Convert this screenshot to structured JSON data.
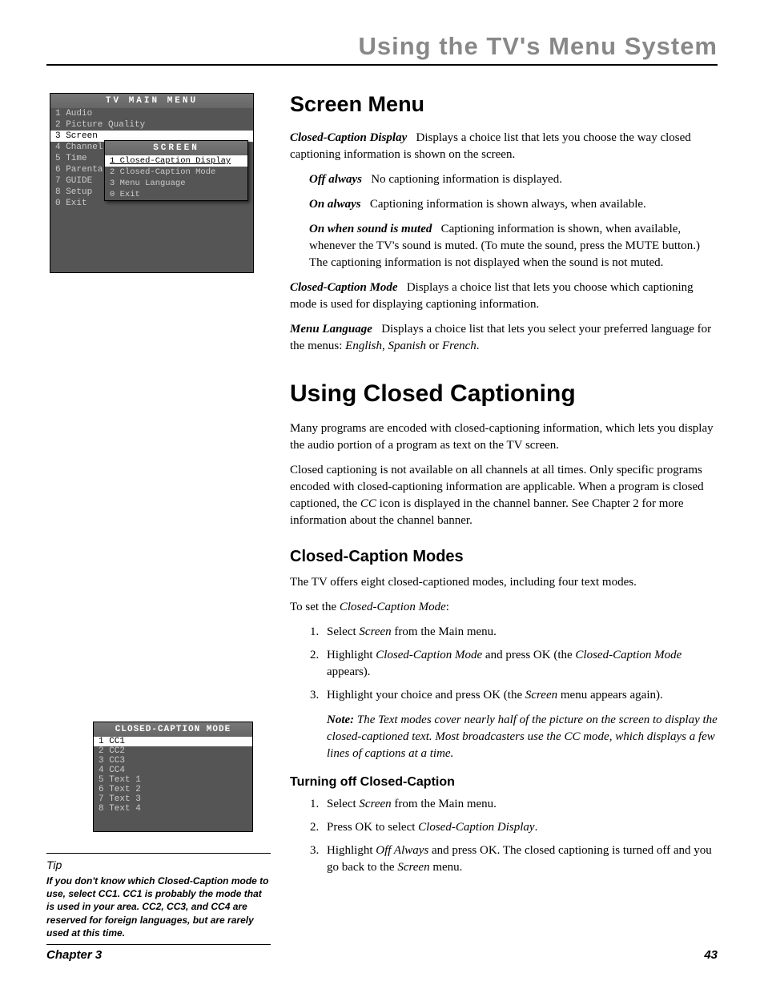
{
  "page_title": "Using the TV's Menu System",
  "tvmenu": {
    "title": "TV MAIN MENU",
    "items": [
      "1 Audio",
      "2 Picture Quality",
      "3 Screen",
      "4 Channel",
      "5 Time",
      "6 Parental",
      "7 GUIDE",
      "8 Setup",
      "0 Exit"
    ],
    "selected_index": 2,
    "submenu": {
      "title": "SCREEN",
      "items": [
        "1 Closed-Caption Display",
        "2 Closed-Caption Mode",
        "3 Menu Language",
        "0 Exit"
      ],
      "selected_index": 0
    }
  },
  "section1": {
    "heading": "Screen Menu",
    "p1_lead": "Closed-Caption Display",
    "p1_rest": "Displays a choice list that lets you choose the way closed captioning information is shown on the screen.",
    "opt1_lead": "Off always",
    "opt1_rest": "No captioning information is displayed.",
    "opt2_lead": "On always",
    "opt2_rest": "Captioning information is shown always, when available.",
    "opt3_lead": "On when sound is muted",
    "opt3_rest": "Captioning information is shown, when available, whenever the TV's sound is muted. (To mute the sound, press the MUTE button.) The captioning information is not displayed when the sound is not muted.",
    "p2_lead": "Closed-Caption Mode",
    "p2_rest": "Displays a choice list that lets you choose which captioning mode is used for displaying captioning information.",
    "p3_lead": "Menu Language",
    "p3_rest_a": "Displays a choice list that lets you select your preferred language for the menus: ",
    "p3_em1": "English",
    "p3_sep1": ", ",
    "p3_em2": "Spanish",
    "p3_sep2": " or ",
    "p3_em3": "French",
    "p3_end": "."
  },
  "section2": {
    "heading": "Using Closed Captioning",
    "p1": "Many programs are encoded with closed-captioning information, which lets you display the audio portion of a program as text on the TV screen.",
    "p2_a": "Closed captioning is not available on all channels at all times. Only specific programs encoded with closed-captioning information are applicable. When a program is closed captioned, the ",
    "p2_em": "CC",
    "p2_b": " icon is displayed in the channel banner. See Chapter 2 for more information about the channel banner."
  },
  "ccmenu": {
    "title": "CLOSED-CAPTION MODE",
    "items": [
      "1 CC1",
      "2 CC2",
      "3 CC3",
      "4 CC4",
      "5 Text 1",
      "6 Text 2",
      "7 Text 3",
      "8 Text 4"
    ],
    "selected_index": 0
  },
  "tip": {
    "label": "Tip",
    "body": "If you don't know which Closed-Caption mode to use, select CC1. CC1 is probably the mode that is used in your area. CC2, CC3, and CC4 are reserved for foreign languages, but are rarely used at this time."
  },
  "section3": {
    "heading": "Closed-Caption Modes",
    "p1": "The TV offers eight closed-captioned modes, including four text modes.",
    "p2_a": "To set the ",
    "p2_em": "Closed-Caption Mode",
    "p2_b": ":",
    "li1_a": "Select ",
    "li1_em": "Screen",
    "li1_b": " from the Main menu.",
    "li2_a": "Highlight ",
    "li2_em1": "Closed-Caption Mode",
    "li2_b": " and press OK  (the ",
    "li2_em2": "Closed-Caption Mode",
    "li2_c": " appears).",
    "li3_a": "Highlight your choice and press OK (the ",
    "li3_em": "Screen",
    "li3_b": " menu appears again).",
    "note_lead": "Note:",
    "note_body": " The Text modes cover nearly half of the picture on the screen to display the closed-captioned text. Most broadcasters use the CC mode, which displays a few lines of captions at a time."
  },
  "section4": {
    "heading": "Turning off Closed-Caption",
    "li1_a": "Select ",
    "li1_em": "Screen",
    "li1_b": " from the Main menu.",
    "li2_a": "Press OK to select ",
    "li2_em": "Closed-Caption Display",
    "li2_b": ".",
    "li3_a": "Highlight ",
    "li3_em1": "Off Always",
    "li3_b": " and press OK. The closed captioning is turned off and you go back to the ",
    "li3_em2": "Screen",
    "li3_c": " menu."
  },
  "footer": {
    "left": "Chapter 3",
    "right": "43"
  }
}
